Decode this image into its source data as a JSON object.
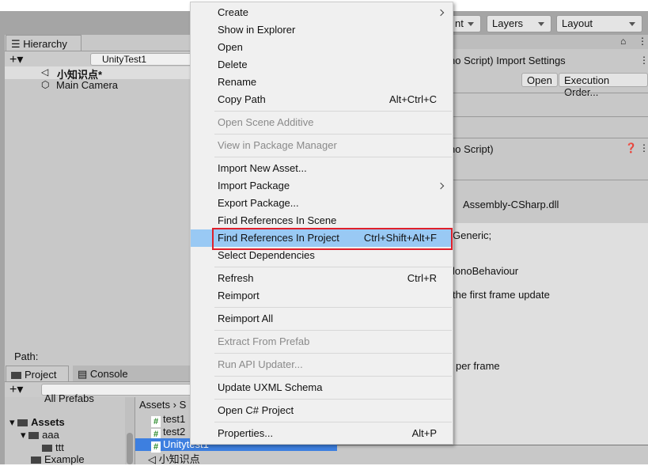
{
  "toolbar": {
    "dd1": "nt",
    "layers": "Layers",
    "layout": "Layout"
  },
  "hierarchy": {
    "tab": "Hierarchy",
    "search": "UnityTest1",
    "scene": "小知识点*",
    "items": [
      "Main Camera"
    ],
    "path_label": "Path:"
  },
  "project": {
    "tabs": [
      "Project",
      "Console"
    ],
    "tree": [
      "All Prefabs",
      "Assets",
      "aaa",
      "ttt",
      "Example"
    ],
    "breadcrumb": [
      "Assets",
      "S"
    ],
    "files": [
      "test1",
      "test2",
      "Unitytest1",
      "小知识点"
    ]
  },
  "inspector": {
    "title": "no Script) Import Settings",
    "open": "Open",
    "exec_order": "Execution Order...",
    "subtitle": "no Script)",
    "assembly": "Assembly-CSharp.dll",
    "code": [
      "Generic;",
      "lonoBehaviour",
      "the first frame update",
      "per frame"
    ]
  },
  "menu": {
    "items": [
      {
        "label": "Create",
        "submenu": true
      },
      {
        "label": "Show in Explorer"
      },
      {
        "label": "Open"
      },
      {
        "label": "Delete"
      },
      {
        "label": "Rename"
      },
      {
        "label": "Copy Path",
        "shortcut": "Alt+Ctrl+C"
      },
      {
        "sep": true
      },
      {
        "label": "Open Scene Additive",
        "disabled": true
      },
      {
        "sep": true
      },
      {
        "label": "View in Package Manager",
        "disabled": true
      },
      {
        "sep": true
      },
      {
        "label": "Import New Asset..."
      },
      {
        "label": "Import Package",
        "submenu": true
      },
      {
        "label": "Export Package..."
      },
      {
        "label": "Find References In Scene"
      },
      {
        "label": "Find References In Project",
        "shortcut": "Ctrl+Shift+Alt+F",
        "highlighted": true
      },
      {
        "label": "Select Dependencies"
      },
      {
        "sep": true
      },
      {
        "label": "Refresh",
        "shortcut": "Ctrl+R"
      },
      {
        "label": "Reimport"
      },
      {
        "sep": true
      },
      {
        "label": "Reimport All"
      },
      {
        "sep": true
      },
      {
        "label": "Extract From Prefab",
        "disabled": true
      },
      {
        "sep": true
      },
      {
        "label": "Run API Updater...",
        "disabled": true
      },
      {
        "sep": true
      },
      {
        "label": "Update UXML Schema"
      },
      {
        "sep": true
      },
      {
        "label": "Open C# Project"
      },
      {
        "sep": true
      },
      {
        "label": "Properties...",
        "shortcut": "Alt+P"
      }
    ]
  },
  "colors": {
    "highlight": "#99c9f4",
    "outline": "#e0202a",
    "selection": "#3d7fe0"
  }
}
